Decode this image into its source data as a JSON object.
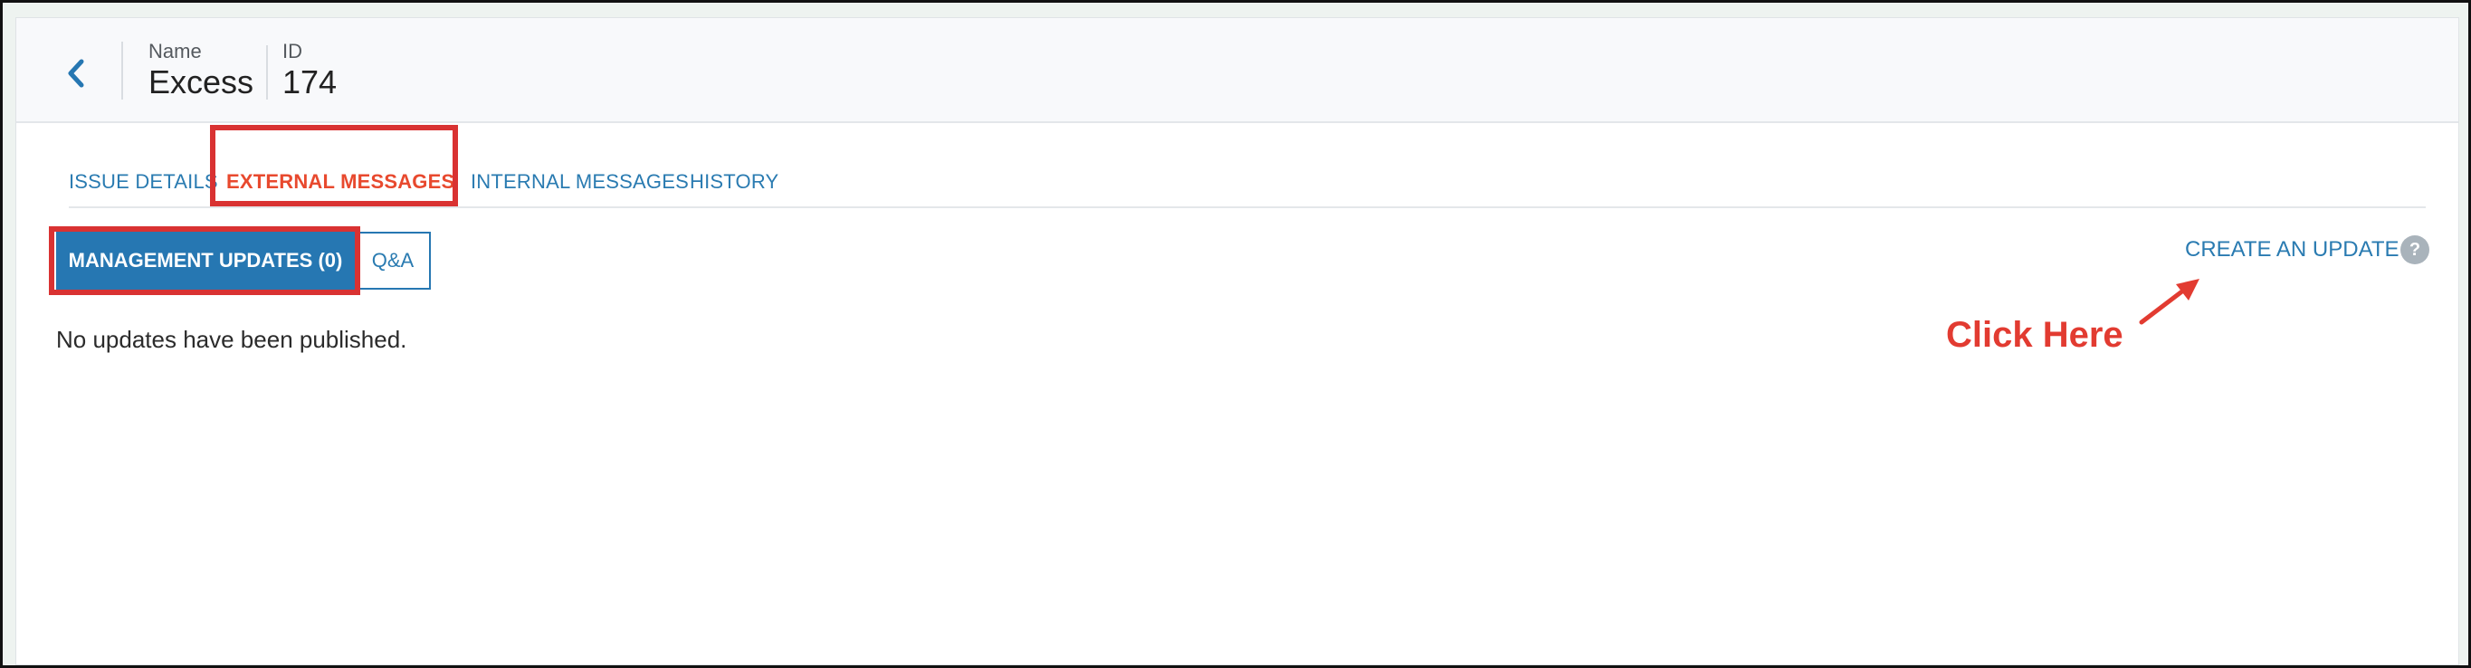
{
  "header": {
    "back_icon": "chevron-left-icon",
    "name_label": "Name",
    "name_value": "Excess",
    "id_label": "ID",
    "id_value": "174"
  },
  "tabs": [
    {
      "label": "ISSUE DETAILS",
      "active": false
    },
    {
      "label": "EXTERNAL MESSAGES",
      "active": true
    },
    {
      "label": "INTERNAL MESSAGES",
      "active": false
    },
    {
      "label": "HISTORY",
      "active": false
    }
  ],
  "toggle": {
    "primary_label": "MANAGEMENT UPDATES (0)",
    "secondary_label": "Q&A"
  },
  "content": {
    "empty_message": "No updates have been published."
  },
  "actions": {
    "create_label": "CREATE AN UPDATE",
    "help_icon": "question-icon",
    "help_glyph": "?"
  },
  "annotation": {
    "callout_text": "Click Here",
    "color": "#e23b31"
  },
  "colors": {
    "accent": "#2677b2",
    "active_tab": "#e8492e",
    "highlight": "#d93232"
  }
}
